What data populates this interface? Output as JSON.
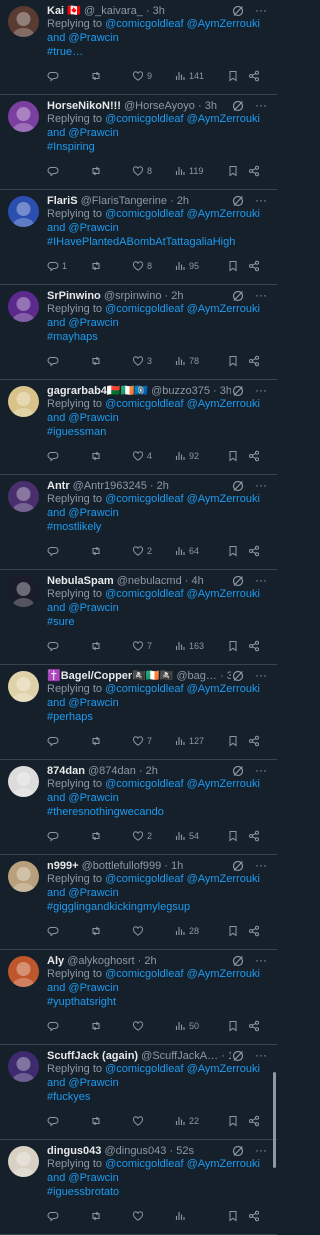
{
  "reply_label": "Replying to",
  "reply_mentions": "@comicgoldleaf @AymZerrouki",
  "reply_and": "and",
  "reply_last": "@Prawcin",
  "separator": "·",
  "colors": {
    "background": "#15202b",
    "accent": "#1d9bf0",
    "muted": "#8b98a5",
    "text": "#e7e9ea",
    "divider": "#38444d"
  },
  "icons": [
    "reply-icon",
    "retweet-icon",
    "like-icon",
    "views-icon",
    "bookmark-icon",
    "share-icon",
    "grok-icon",
    "more-icon"
  ],
  "tweets": [
    {
      "name": "Kai 🇨🇦",
      "handle": "@_kaivara_",
      "time": "3h",
      "hashtag": "#true…",
      "replies": "",
      "likes": "9",
      "views": "141",
      "avatar": "#5a3b32"
    },
    {
      "name": "HorseNikoN!!!",
      "handle": "@HorseAyoyo",
      "time": "3h",
      "hashtag": "#Inspiring",
      "replies": "",
      "likes": "8",
      "views": "119",
      "avatar": "#7b3fa0"
    },
    {
      "name": "FlariS",
      "handle": "@FlarisTangerine",
      "time": "2h",
      "hashtag": "#IHavePlantedABombAtTattagaliaHigh",
      "replies": "1",
      "likes": "8",
      "views": "95",
      "avatar": "#2a4fb0"
    },
    {
      "name": "SrPinwino",
      "handle": "@srpinwino",
      "time": "2h",
      "hashtag": "#mayhaps",
      "replies": "",
      "likes": "3",
      "views": "78",
      "avatar": "#5b2a8c"
    },
    {
      "name": "gagrarbab4🇲🇬🇮🇪🇲🇵",
      "handle": "@buzzo375",
      "time": "3h",
      "hashtag": "#iguessman",
      "replies": "",
      "likes": "4",
      "views": "92",
      "avatar": "#d8c48a"
    },
    {
      "name": "Antr",
      "handle": "@Antr1963245",
      "time": "2h",
      "hashtag": "#mostlikely",
      "replies": "",
      "likes": "2",
      "views": "64",
      "avatar": "#4a2f6e"
    },
    {
      "name": "NebulaSpam",
      "handle": "@nebulacmd",
      "time": "4h",
      "hashtag": "#sure",
      "replies": "",
      "likes": "7",
      "views": "163",
      "avatar": "#1b1b2a"
    },
    {
      "name": "✝️Bagel/Copper🏴‍☠️🇮🇪🏴‍☠️",
      "handle": "@bag…",
      "time": "3h",
      "hashtag": "#perhaps",
      "replies": "",
      "likes": "7",
      "views": "127",
      "avatar": "#e0d2a8"
    },
    {
      "name": "874dan",
      "handle": "@874dan",
      "time": "2h",
      "hashtag": "#theresnothingwecando",
      "replies": "",
      "likes": "2",
      "views": "54",
      "avatar": "#dcdcdc"
    },
    {
      "name": "n999+",
      "handle": "@bottlefullof999",
      "time": "1h",
      "hashtag": "#gigglingandkickingmylegsup",
      "replies": "",
      "likes": "",
      "views": "28",
      "avatar": "#b9a07c"
    },
    {
      "name": "Aly",
      "handle": "@alykoghosrt",
      "time": "2h",
      "hashtag": "#yupthatsright",
      "replies": "",
      "likes": "",
      "views": "50",
      "avatar": "#c0562c"
    },
    {
      "name": "ScuffJack (again)",
      "handle": "@ScuffJackA…",
      "time": "1h",
      "hashtag": "#fuckyes",
      "replies": "",
      "likes": "",
      "views": "22",
      "avatar": "#3e2a6e"
    },
    {
      "name": "dingus043",
      "handle": "@dingus043",
      "time": "52s",
      "hashtag": "#iguessbrotato",
      "replies": "",
      "likes": "",
      "views": "",
      "avatar": "#d9d2c4"
    }
  ]
}
